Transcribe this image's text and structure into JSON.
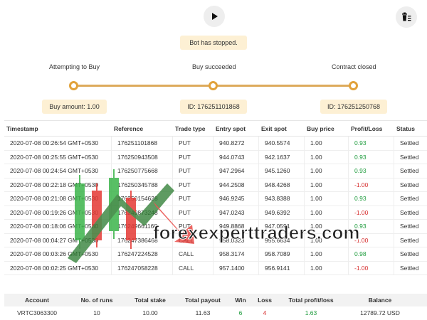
{
  "controls": {
    "play_icon": "play-icon",
    "clear_icon": "trash-icon"
  },
  "status": "Bot has stopped.",
  "progress": {
    "steps": [
      {
        "label": "Attempting to Buy",
        "info": "Buy amount: 1.00"
      },
      {
        "label": "Buy succeeded",
        "info": "ID: 176251101868"
      },
      {
        "label": "Contract closed",
        "info": "ID: 176251250768"
      }
    ],
    "accent_color": "#e1a23b"
  },
  "transactions": {
    "headers": [
      "Timestamp",
      "Reference",
      "Trade type",
      "Entry spot",
      "Exit spot",
      "Buy price",
      "Profit/Loss",
      "Status"
    ],
    "rows": [
      {
        "timestamp": "2020-07-08 00:26:54 GMT+0530",
        "reference": "176251101868",
        "type": "PUT",
        "entry": "940.8272",
        "exit": "940.5574",
        "buy": "1.00",
        "pl": "0.93",
        "status": "Settled"
      },
      {
        "timestamp": "2020-07-08 00:25:55 GMT+0530",
        "reference": "176250943508",
        "type": "PUT",
        "entry": "944.0743",
        "exit": "942.1637",
        "buy": "1.00",
        "pl": "0.93",
        "status": "Settled"
      },
      {
        "timestamp": "2020-07-08 00:24:54 GMT+0530",
        "reference": "176250775668",
        "type": "PUT",
        "entry": "947.2964",
        "exit": "945.1260",
        "buy": "1.00",
        "pl": "0.93",
        "status": "Settled"
      },
      {
        "timestamp": "2020-07-08 00:22:18 GMT+0530",
        "reference": "176250345788",
        "type": "PUT",
        "entry": "944.2508",
        "exit": "948.4268",
        "buy": "1.00",
        "pl": "-1.00",
        "status": "Settled"
      },
      {
        "timestamp": "2020-07-08 00:21:08 GMT+0530",
        "reference": "176250154628",
        "type": "PUT",
        "entry": "946.9245",
        "exit": "943.8388",
        "buy": "1.00",
        "pl": "0.93",
        "status": "Settled"
      },
      {
        "timestamp": "2020-07-08 00:19:26 GMT+0530",
        "reference": "176249873248",
        "type": "PUT",
        "entry": "947.0243",
        "exit": "949.6392",
        "buy": "1.00",
        "pl": "-1.00",
        "status": "Settled"
      },
      {
        "timestamp": "2020-07-08 00:18:06 GMT+0530",
        "reference": "176249661168",
        "type": "PUT",
        "entry": "949.8868",
        "exit": "947.0591",
        "buy": "1.00",
        "pl": "0.93",
        "status": "Settled"
      },
      {
        "timestamp": "2020-07-08 00:04:27 GMT+0530",
        "reference": "176247386468",
        "type": "CALL",
        "entry": "958.0323",
        "exit": "955.6634",
        "buy": "1.00",
        "pl": "-1.00",
        "status": "Settled"
      },
      {
        "timestamp": "2020-07-08 00:03:26 GMT+0530",
        "reference": "176247224528",
        "type": "CALL",
        "entry": "958.3174",
        "exit": "958.7089",
        "buy": "1.00",
        "pl": "0.98",
        "status": "Settled"
      },
      {
        "timestamp": "2020-07-08 00:02:25 GMT+0530",
        "reference": "176247058228",
        "type": "CALL",
        "entry": "957.1400",
        "exit": "956.9141",
        "buy": "1.00",
        "pl": "-1.00",
        "status": "Settled"
      }
    ],
    "win_color": "#1d9b3c",
    "loss_color": "#d62f2f"
  },
  "watermark": {
    "text": "forexexperttraders.com"
  },
  "summary": {
    "headers": [
      "Account",
      "No. of runs",
      "Total stake",
      "Total payout",
      "Win",
      "Loss",
      "Total profit/loss",
      "Balance"
    ],
    "values": [
      "VRTC3063300",
      "10",
      "10.00",
      "11.63",
      "6",
      "4",
      "1.63",
      "12789.72 USD"
    ]
  }
}
